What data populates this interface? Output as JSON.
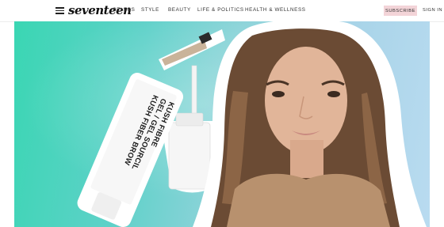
{
  "header": {
    "logo": "seventeen",
    "nav": [
      "CELEBS",
      "STYLE",
      "BEAUTY",
      "LIFE & POLITICS",
      "HEALTH & WELLNESS"
    ],
    "subscribe_label": "SUBSCRIBE",
    "signin_label": "SIGN IN"
  },
  "hero": {
    "product_text": [
      "KUSH FIBER BROW",
      "GEL / GEL SOURCIL",
      "KUSH FIBRE"
    ]
  },
  "colors": {
    "background_teal": "#3ad6b3",
    "background_blue": "#b9dbf0",
    "subscribe_bg": "#f3d4d8"
  }
}
